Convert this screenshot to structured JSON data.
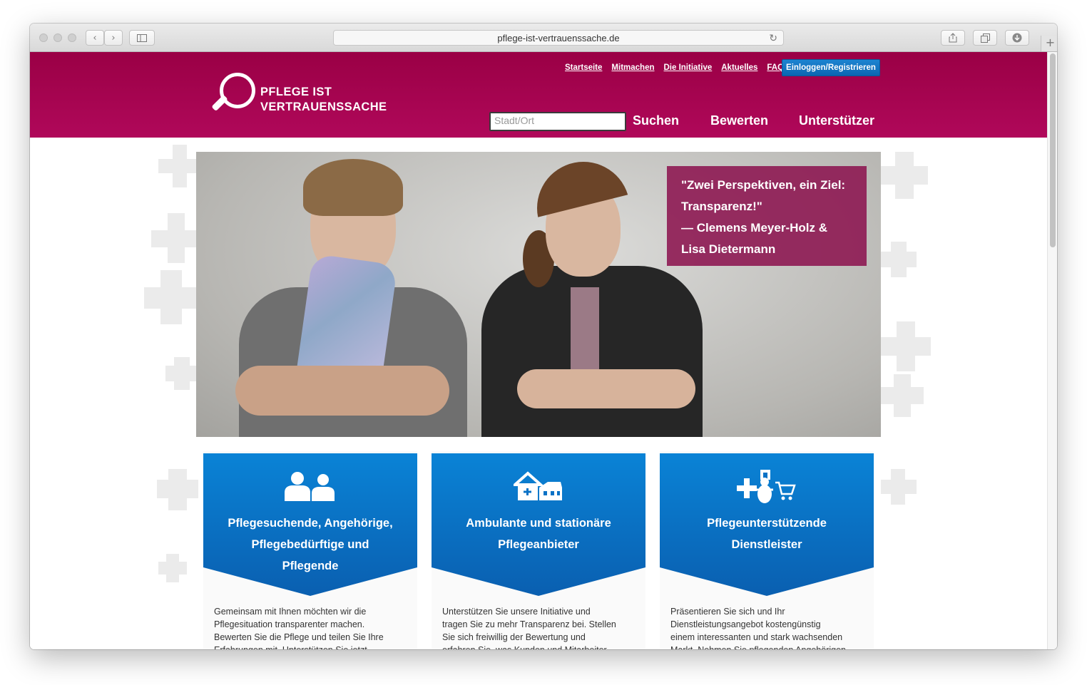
{
  "browser": {
    "url": "pflege-ist-vertrauenssache.de"
  },
  "logo": {
    "line1": "PFLEGE IST",
    "line2": "VERTRAUENSSACHE"
  },
  "topnav": {
    "items": [
      "Startseite",
      "Mitmachen",
      "Die Initiative",
      "Aktuelles",
      "FAQ"
    ],
    "login_label": "Einloggen/Registrieren"
  },
  "search": {
    "placeholder": "Stadt/Ort"
  },
  "mainnav": {
    "items": [
      "Suchen",
      "Bewerten",
      "Unterstützer"
    ]
  },
  "hero": {
    "quote_line1": "\"Zwei Perspektiven, ein Ziel:",
    "quote_line2": "Transparenz!\"",
    "quote_line3": "— Clemens Meyer-Holz &",
    "quote_line4": "Lisa Dietermann"
  },
  "cards": [
    {
      "icon": "people-icon",
      "title_lines": [
        "Pflegesuchende, Angehörige,",
        "Pflegebedürftige und",
        "Pflegende"
      ],
      "text_lines": [
        "Gemeinsam mit Ihnen möchten wir die",
        "Pflegesituation transparenter machen.",
        "Bewerten Sie die Pflege und teilen Sie Ihre",
        "Erfahrungen mit. Unterstützen Sie jetzt"
      ]
    },
    {
      "icon": "nursing-home-icon",
      "title_lines": [
        "Ambulante und stationäre",
        "Pflegeanbieter"
      ],
      "text_lines": [
        "Unterstützen Sie unsere Initiative und",
        "tragen Sie zu mehr Transparenz bei. Stellen",
        "Sie sich freiwillig der Bewertung und",
        "erfahren Sie, was Kunden und Mitarbeiter"
      ]
    },
    {
      "icon": "service-providers-icon",
      "title_lines": [
        "Pflegeunterstützende",
        "Dienstleister"
      ],
      "text_lines": [
        "Präsentieren Sie sich und Ihr",
        "Dienstleistungsangebot kostengünstig",
        "einem interessanten und stark wachsenden",
        "Markt. Nehmen Sie pflegenden Angehörigen"
      ]
    }
  ],
  "colors": {
    "brand_magenta": "#a8004f",
    "brand_blue": "#0a6fc2",
    "quote_bg": "#8c1450"
  }
}
